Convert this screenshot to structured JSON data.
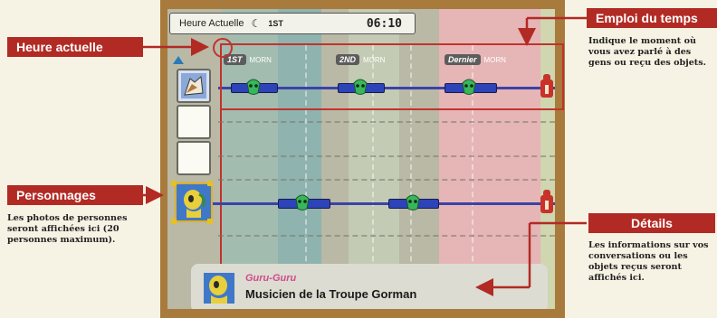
{
  "callouts": {
    "current_time": {
      "label": "Heure actuelle"
    },
    "schedule": {
      "label": "Emploi du temps",
      "description": "Indique le moment où vous avez parlé à des gens ou reçu des objets."
    },
    "characters": {
      "label": "Personnages",
      "description": "Les photos de personnes seront affichées ici (20 personnes maximum)."
    },
    "details": {
      "label": "Détails",
      "description": "Les informations sur vos conversations ou les objets reçus seront affichés ici."
    }
  },
  "game": {
    "clock": {
      "label": "Heure Actuelle",
      "day_label": "1ST",
      "time": "06:10"
    },
    "days": [
      {
        "badge": "1ST",
        "sub": "MORN"
      },
      {
        "badge": "2ND",
        "sub": "MORN"
      },
      {
        "badge": "Dernier",
        "sub": "MORN"
      }
    ],
    "detail": {
      "name": "Guru-Guru",
      "description": "Musicien de la Troupe Gorman"
    },
    "colors": {
      "red": "#b22a24",
      "blue": "#2c44b8",
      "mask": "#32b45a",
      "day1_band": "#8ab4b0",
      "day3_band": "#e8b2b6"
    }
  }
}
